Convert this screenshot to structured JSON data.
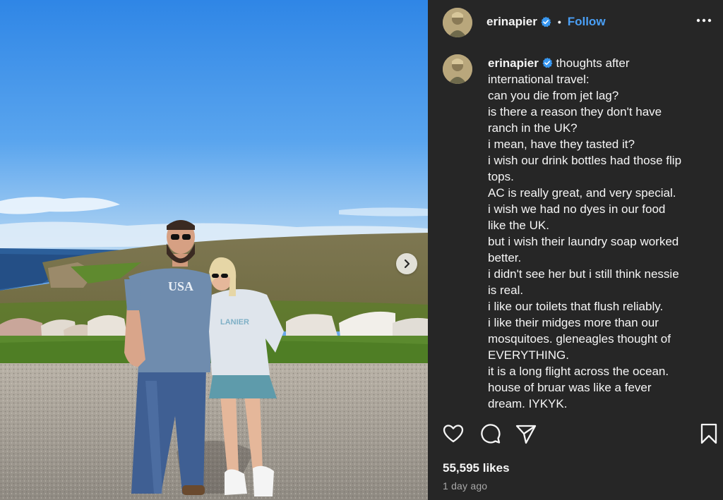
{
  "colors": {
    "panel_bg": "#262626",
    "text": "#f5f5f5",
    "follow_blue": "#4a9ff5",
    "verified_blue": "#3897f0",
    "muted": "#a8a8a8"
  },
  "photo": {
    "shirt_text_him": "USA",
    "shirt_text_her": "LANIER",
    "next_icon": "chevron-right-icon"
  },
  "header": {
    "username": "erinapier",
    "separator": "•",
    "follow_label": "Follow",
    "more_icon": "more-horizontal-icon"
  },
  "caption": {
    "username": "erinapier",
    "lines": [
      "thoughts after",
      "international travel:",
      "can you die from jet lag?",
      "is there a reason they don't have",
      "ranch in the UK?",
      "i mean, have they tasted it?",
      "i wish our drink bottles had those flip",
      "tops.",
      "AC is really great, and very special.",
      "i wish we had no dyes in our food",
      "like the UK.",
      "but i wish their laundry soap worked",
      "better.",
      "i didn't see her but i still think nessie",
      "is real.",
      "i like our toilets that flush reliably.",
      "i like their midges more than our",
      "mosquitoes. gleneagles thought of",
      "EVERYTHING.",
      "it is a long flight across the ocean.",
      "house of bruar was like a fever",
      "dream. IYKYK."
    ]
  },
  "actions": {
    "like_icon": "heart-icon",
    "comment_icon": "comment-icon",
    "share_icon": "paper-plane-icon",
    "save_icon": "bookmark-icon"
  },
  "likes": "55,595 likes",
  "timestamp": "1 day ago"
}
